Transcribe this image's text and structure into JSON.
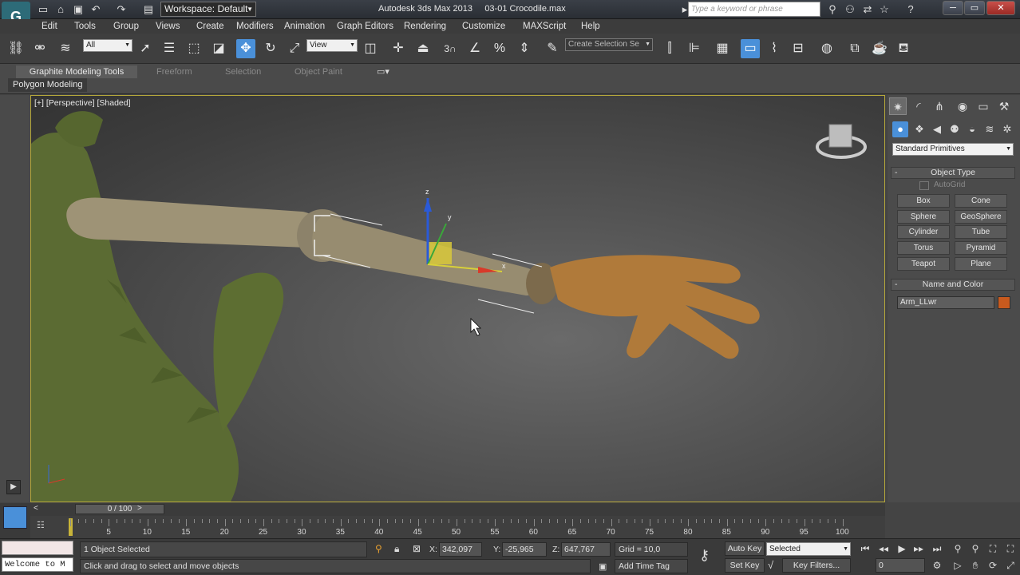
{
  "title_bar": {
    "workspace_label": "Workspace: Default",
    "app_title": "Autodesk 3ds Max  2013",
    "file_name": "03-01 Crocodile.max",
    "search_placeholder": "Type a keyword or phrase"
  },
  "menu": [
    "Edit",
    "Tools",
    "Group",
    "Views",
    "Create",
    "Modifiers",
    "Animation",
    "Graph Editors",
    "Rendering",
    "Customize",
    "MAXScript",
    "Help"
  ],
  "toolbar": {
    "selection_filter": "All",
    "ref_coord_system": "View",
    "snap_number": "3",
    "named_selection_placeholder": "Create Selection Se"
  },
  "ribbon": {
    "tabs": [
      "Graphite Modeling Tools",
      "Freeform",
      "Selection",
      "Object Paint"
    ],
    "panel_tab": "Polygon Modeling"
  },
  "viewport": {
    "label": "[+] [Perspective] [Shaded]",
    "gizmo_axes": [
      "z",
      "y",
      "x"
    ]
  },
  "command_panel": {
    "category": "Standard Primitives",
    "object_type_title": "Object Type",
    "autogrid": "AutoGrid",
    "object_buttons": [
      "Box",
      "Cone",
      "Sphere",
      "GeoSphere",
      "Cylinder",
      "Tube",
      "Torus",
      "Pyramid",
      "Teapot",
      "Plane"
    ],
    "name_color_title": "Name and Color",
    "object_name": "Arm_LLwr",
    "object_color": "#c85a1e"
  },
  "timeline": {
    "frame_label": "0 / 100",
    "ticks": [
      "5",
      "10",
      "15",
      "20",
      "25",
      "30",
      "35",
      "40",
      "45",
      "50",
      "55",
      "60",
      "65",
      "70",
      "75",
      "80",
      "85",
      "90",
      "95",
      "100"
    ]
  },
  "status": {
    "maxscript_listener": "Welcome to M",
    "selection_info": "1 Object Selected",
    "prompt": "Click and drag to select and move objects",
    "x_label": "X:",
    "x_value": "342,097",
    "y_label": "Y:",
    "y_value": "-25,965",
    "z_label": "Z:",
    "z_value": "647,767",
    "grid": "Grid = 10,0",
    "add_time_tag": "Add Time Tag",
    "auto_key": "Auto Key",
    "set_key": "Set Key",
    "key_mode": "Selected",
    "key_filters": "Key Filters...",
    "current_frame": "0"
  },
  "colors": {
    "viewport_border": "#b7a93b",
    "active_blue": "#4a90d9"
  }
}
